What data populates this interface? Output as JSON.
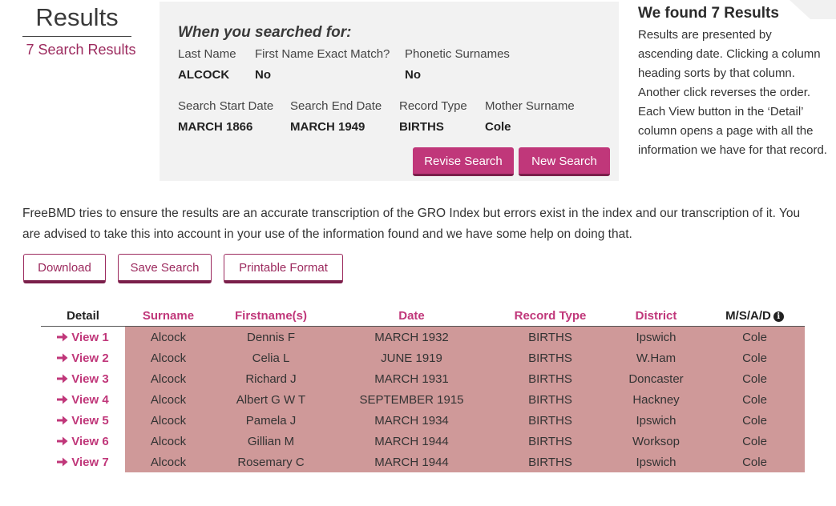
{
  "header": {
    "title": "Results",
    "count_text": "7 Search Results"
  },
  "search": {
    "heading": "When you searched for:",
    "fields": {
      "last_name": {
        "label": "Last Name",
        "value": "ALCOCK"
      },
      "first_name_exact": {
        "label": "First Name Exact Match?",
        "value": "No"
      },
      "phonetic": {
        "label": "Phonetic Surnames",
        "value": "No"
      },
      "start_date": {
        "label": "Search Start Date",
        "value": "MARCH 1866"
      },
      "end_date": {
        "label": "Search End Date",
        "value": "MARCH 1949"
      },
      "record_type": {
        "label": "Record Type",
        "value": "BIRTHS"
      },
      "mother_surname": {
        "label": "Mother Surname",
        "value": "Cole"
      }
    },
    "revise_label": "Revise Search",
    "new_label": "New Search"
  },
  "info": {
    "title": "We found 7 Results",
    "text": "Results are presented by ascending date. Clicking a column heading sorts by that column. Another click reverses the order. Each View button in the ‘Detail’ column opens a page with all the information we have for that record."
  },
  "disclaimer": "FreeBMD tries to ensure the results are an accurate transcription of the GRO Index but errors exist in the index and our transcription of it. You are advised to take this into account in your use of the information found and we have some help on doing that.",
  "actions": {
    "download": "Download",
    "save_search": "Save Search",
    "printable": "Printable Format"
  },
  "table": {
    "headers": {
      "detail": "Detail",
      "surname": "Surname",
      "firstnames": "Firstname(s)",
      "date": "Date",
      "record_type": "Record Type",
      "district": "District",
      "msad": "M/S/A/D"
    },
    "rows": [
      {
        "view": "View 1",
        "surname": "Alcock",
        "firstnames": "Dennis F",
        "date": "MARCH 1932",
        "record_type": "BIRTHS",
        "district": "Ipswich",
        "msad": "Cole"
      },
      {
        "view": "View 2",
        "surname": "Alcock",
        "firstnames": "Celia L",
        "date": "JUNE 1919",
        "record_type": "BIRTHS",
        "district": "W.Ham",
        "msad": "Cole"
      },
      {
        "view": "View 3",
        "surname": "Alcock",
        "firstnames": "Richard J",
        "date": "MARCH 1931",
        "record_type": "BIRTHS",
        "district": "Doncaster",
        "msad": "Cole"
      },
      {
        "view": "View 4",
        "surname": "Alcock",
        "firstnames": "Albert G W T",
        "date": "SEPTEMBER 1915",
        "record_type": "BIRTHS",
        "district": "Hackney",
        "msad": "Cole"
      },
      {
        "view": "View 5",
        "surname": "Alcock",
        "firstnames": "Pamela J",
        "date": "MARCH 1934",
        "record_type": "BIRTHS",
        "district": "Ipswich",
        "msad": "Cole"
      },
      {
        "view": "View 6",
        "surname": "Alcock",
        "firstnames": "Gillian M",
        "date": "MARCH 1944",
        "record_type": "BIRTHS",
        "district": "Worksop",
        "msad": "Cole"
      },
      {
        "view": "View 7",
        "surname": "Alcock",
        "firstnames": "Rosemary C",
        "date": "MARCH 1944",
        "record_type": "BIRTHS",
        "district": "Ipswich",
        "msad": "Cole"
      }
    ]
  },
  "colors": {
    "accent": "#c0377a",
    "row_shade": "#cf9999",
    "panel_bg": "#f2f2f2"
  }
}
